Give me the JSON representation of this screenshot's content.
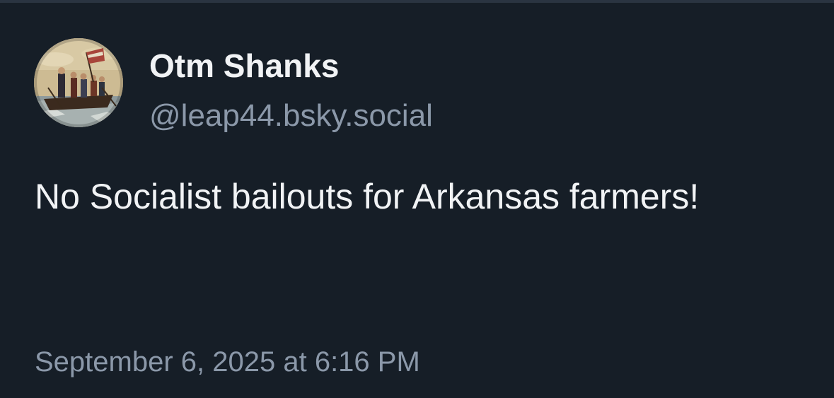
{
  "colors": {
    "background": "#161e27",
    "divider": "#2a3441",
    "primary_text": "#f1f3f5",
    "secondary_text": "#8b98a9"
  },
  "author": {
    "display_name": "Otm Shanks",
    "handle": "@leap44.bsky.social",
    "avatar_icon": "painting-avatar"
  },
  "post": {
    "text": "No Socialist bailouts for Arkansas farmers!",
    "timestamp": "September 6, 2025 at 6:16 PM"
  }
}
